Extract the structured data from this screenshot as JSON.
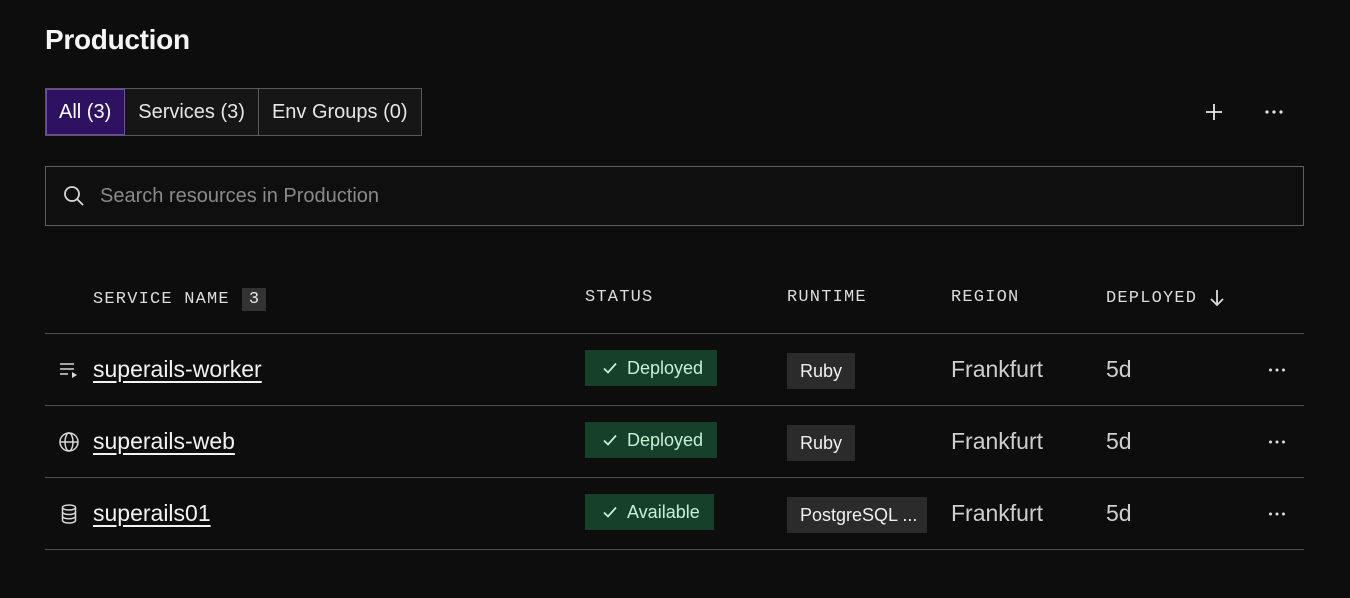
{
  "page": {
    "title": "Production"
  },
  "tabs": [
    {
      "label": "All (3)",
      "active": true
    },
    {
      "label": "Services (3)",
      "active": false
    },
    {
      "label": "Env Groups (0)",
      "active": false
    }
  ],
  "search": {
    "placeholder": "Search resources in Production"
  },
  "table": {
    "headers": {
      "service_name": "SERVICE NAME",
      "service_count": "3",
      "status": "STATUS",
      "runtime": "RUNTIME",
      "region": "REGION",
      "deployed": "DEPLOYED"
    },
    "rows": [
      {
        "icon": "worker-icon",
        "name": "superails-worker",
        "status": "Deployed",
        "runtime": "Ruby",
        "region": "Frankfurt",
        "deployed": "5d"
      },
      {
        "icon": "globe-icon",
        "name": "superails-web",
        "status": "Deployed",
        "runtime": "Ruby",
        "region": "Frankfurt",
        "deployed": "5d"
      },
      {
        "icon": "database-icon",
        "name": "superails01",
        "status": "Available",
        "runtime": "PostgreSQL ...",
        "region": "Frankfurt",
        "deployed": "5d"
      }
    ]
  },
  "colors": {
    "background": "#0d0d0d",
    "tab_active": "#2e1160",
    "status_bg": "#17402a",
    "status_text": "#c9f0d6",
    "runtime_bg": "#2b2b2b"
  }
}
